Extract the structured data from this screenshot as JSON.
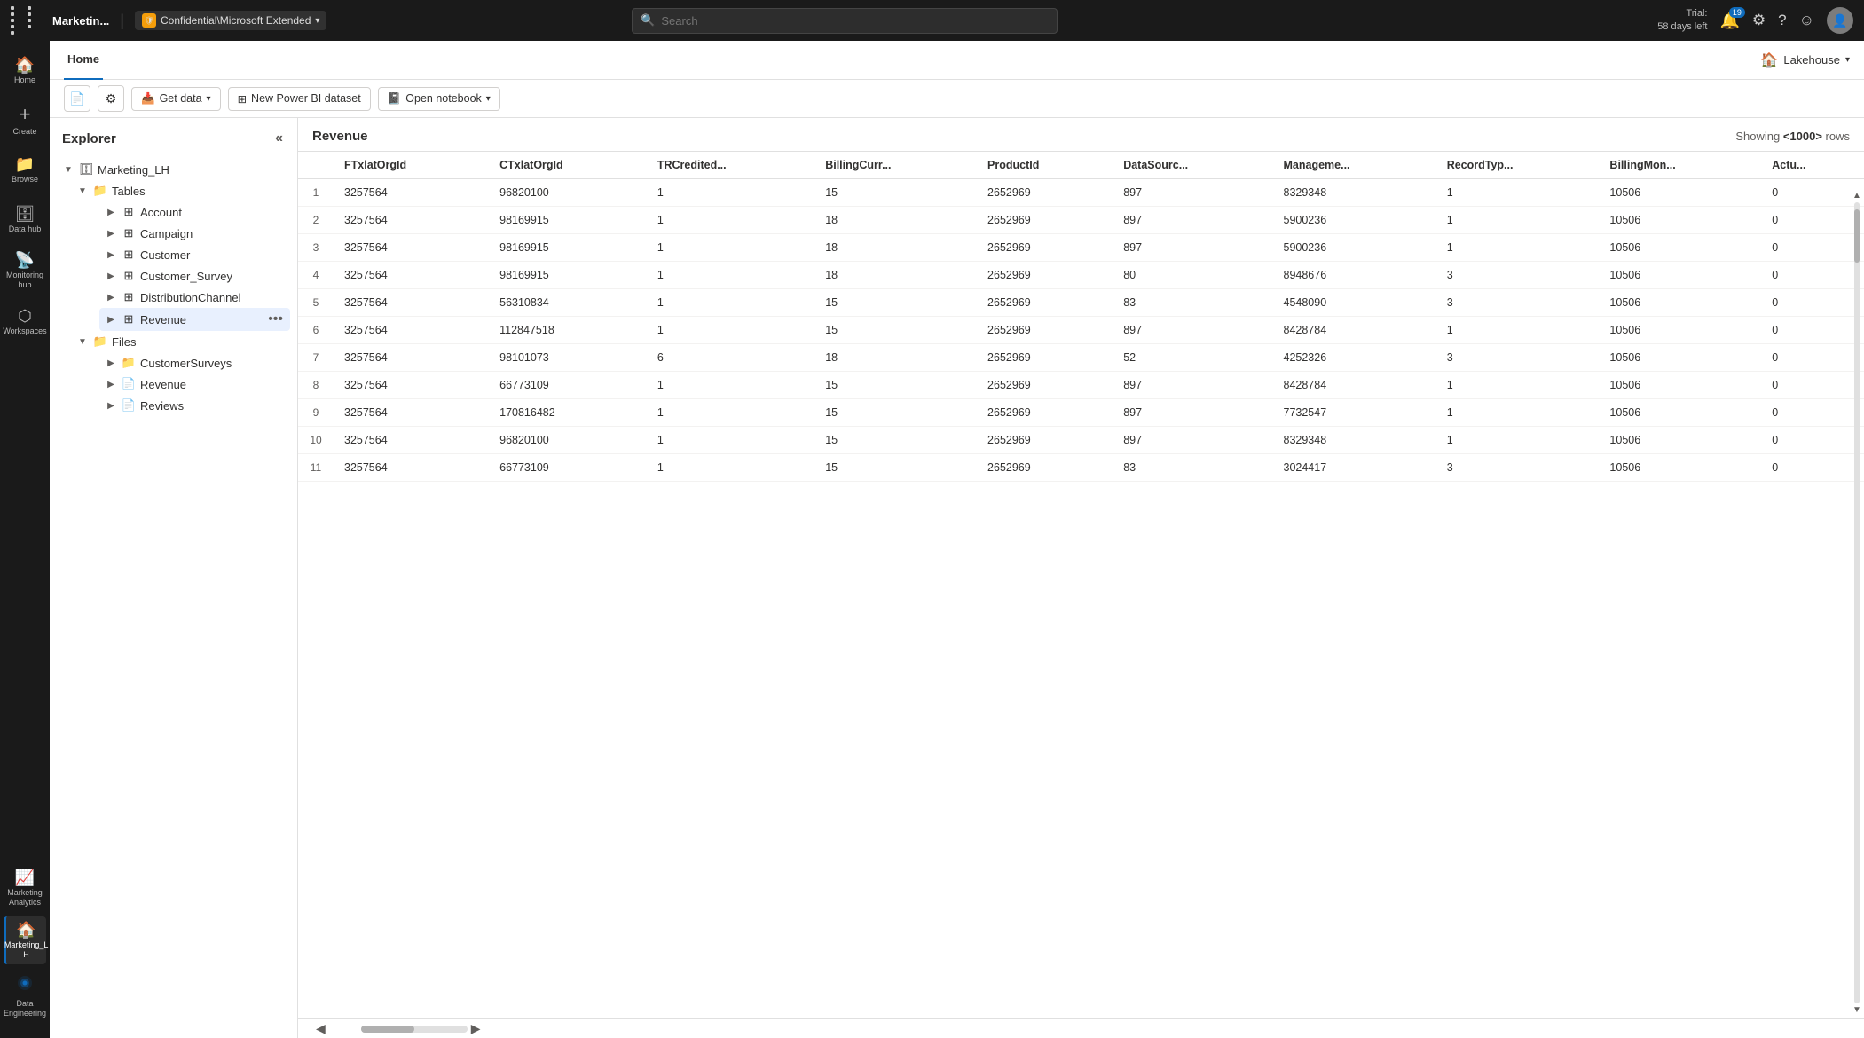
{
  "topbar": {
    "app_name": "Marketin...",
    "sensitivity_label": "Confidential\\Microsoft Extended",
    "search_placeholder": "Search",
    "trial_line1": "Trial:",
    "trial_line2": "58 days left",
    "notif_count": "19"
  },
  "header": {
    "tab_label": "Home",
    "lakehouse_label": "Lakehouse"
  },
  "toolbar": {
    "get_data_label": "Get data",
    "new_dataset_label": "New Power BI dataset",
    "open_notebook_label": "Open notebook"
  },
  "explorer": {
    "title": "Explorer",
    "root": {
      "name": "Marketing_LH",
      "children": [
        {
          "label": "Tables",
          "type": "folder",
          "children": [
            {
              "label": "Account",
              "type": "table"
            },
            {
              "label": "Campaign",
              "type": "table"
            },
            {
              "label": "Customer",
              "type": "table"
            },
            {
              "label": "Customer_Survey",
              "type": "table"
            },
            {
              "label": "DistributionChannel",
              "type": "table"
            },
            {
              "label": "Revenue",
              "type": "table",
              "active": true
            }
          ]
        },
        {
          "label": "Files",
          "type": "folder",
          "children": [
            {
              "label": "CustomerSurveys",
              "type": "file-folder"
            },
            {
              "label": "Revenue",
              "type": "file"
            },
            {
              "label": "Reviews",
              "type": "file"
            }
          ]
        }
      ]
    }
  },
  "datagrid": {
    "table_name": "Revenue",
    "rows_label": "Showing <1000> rows",
    "columns": [
      "",
      "FTxlatOrgId",
      "CTxlatOrgId",
      "TRCredited...",
      "BillingCurr...",
      "ProductId",
      "DataSourc...",
      "Manageme...",
      "RecordTyp...",
      "BillingMon...",
      "Actu..."
    ],
    "rows": [
      [
        1,
        "3257564",
        "96820100",
        "1",
        "15",
        "2652969",
        "897",
        "8329348",
        "1",
        "10506",
        "0"
      ],
      [
        2,
        "3257564",
        "98169915",
        "1",
        "18",
        "2652969",
        "897",
        "5900236",
        "1",
        "10506",
        "0"
      ],
      [
        3,
        "3257564",
        "98169915",
        "1",
        "18",
        "2652969",
        "897",
        "5900236",
        "1",
        "10506",
        "0"
      ],
      [
        4,
        "3257564",
        "98169915",
        "1",
        "18",
        "2652969",
        "80",
        "8948676",
        "3",
        "10506",
        "0"
      ],
      [
        5,
        "3257564",
        "56310834",
        "1",
        "15",
        "2652969",
        "83",
        "4548090",
        "3",
        "10506",
        "0"
      ],
      [
        6,
        "3257564",
        "112847518",
        "1",
        "15",
        "2652969",
        "897",
        "8428784",
        "1",
        "10506",
        "0"
      ],
      [
        7,
        "3257564",
        "98101073",
        "6",
        "18",
        "2652969",
        "52",
        "4252326",
        "3",
        "10506",
        "0"
      ],
      [
        8,
        "3257564",
        "66773109",
        "1",
        "15",
        "2652969",
        "897",
        "8428784",
        "1",
        "10506",
        "0"
      ],
      [
        9,
        "3257564",
        "170816482",
        "1",
        "15",
        "2652969",
        "897",
        "7732547",
        "1",
        "10506",
        "0"
      ],
      [
        10,
        "3257564",
        "96820100",
        "1",
        "15",
        "2652969",
        "897",
        "8329348",
        "1",
        "10506",
        "0"
      ],
      [
        11,
        "3257564",
        "66773109",
        "1",
        "15",
        "2652969",
        "83",
        "3024417",
        "3",
        "10506",
        "0"
      ]
    ]
  },
  "nav": {
    "items": [
      {
        "id": "home",
        "label": "Home",
        "icon": "🏠"
      },
      {
        "id": "create",
        "label": "Create",
        "icon": "＋"
      },
      {
        "id": "browse",
        "label": "Browse",
        "icon": "📁"
      },
      {
        "id": "data-hub",
        "label": "Data hub",
        "icon": "⊙"
      },
      {
        "id": "monitoring",
        "label": "Monitoring hub",
        "icon": "📊"
      },
      {
        "id": "workspaces",
        "label": "Workspaces",
        "icon": "⬡"
      },
      {
        "id": "marketing-analytics",
        "label": "Marketing Analytics",
        "icon": "📈"
      },
      {
        "id": "marketing-lh",
        "label": "Marketing_L H",
        "icon": "🏠",
        "active": true
      }
    ],
    "bottom": [
      {
        "id": "data-engineering",
        "label": "Data Engineering",
        "icon": "⚙"
      }
    ]
  }
}
